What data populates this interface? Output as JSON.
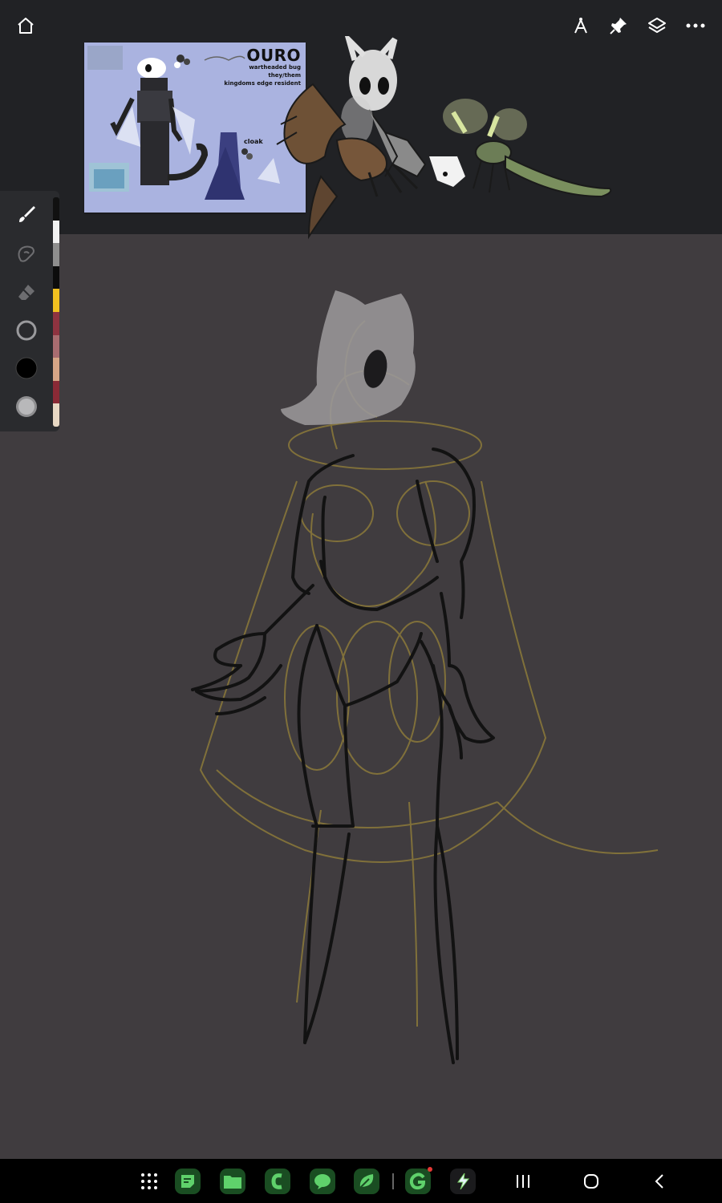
{
  "reference_sheet": {
    "title": "OURO",
    "subtitle_1": "wartheaded bug",
    "subtitle_2": "they/them",
    "subtitle_3": "kingdoms edge resident",
    "cloak_label": "cloak"
  },
  "palette": {
    "colors": [
      "#111111",
      "#f2f2f2",
      "#8e8e8e",
      "#0c0c0c",
      "#f0c020",
      "#8e3340",
      "#a86c70",
      "#d6a586",
      "#8a2a36",
      "#e8d8c4"
    ]
  },
  "accent": {
    "taskbar_green": "#1f8f30",
    "sketch_black": "#121212",
    "sketch_gold": "#8c7a3a"
  },
  "icons": {
    "top_left": "home-icon",
    "top_right": [
      "compass-icon",
      "pin-icon",
      "layers-icon",
      "more-icon"
    ],
    "tools": [
      "brush-icon",
      "smudge-icon",
      "eraser-icon",
      "brush-size-icon",
      "color-icon",
      "opacity-icon"
    ],
    "nav": [
      "apps-grid-icon",
      "recents-icon",
      "home-circle-icon",
      "back-icon"
    ]
  }
}
